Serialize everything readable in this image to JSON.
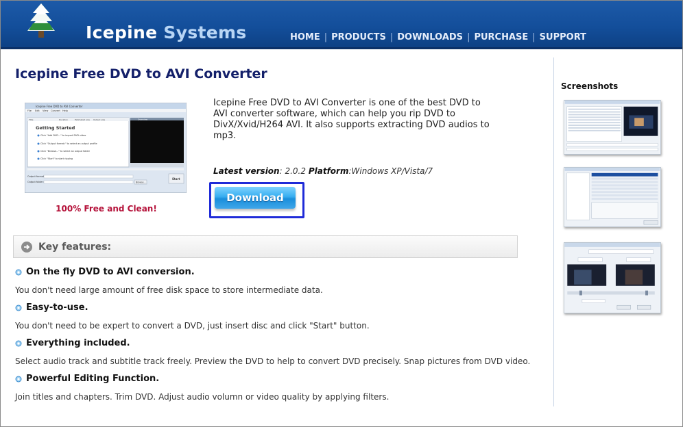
{
  "brand": {
    "name_part1": "Icepine",
    "name_part2": "Systems"
  },
  "nav": {
    "items": [
      "HOME",
      "PRODUCTS",
      "DOWNLOADS",
      "PURCHASE",
      "SUPPORT"
    ],
    "separator": "|"
  },
  "product": {
    "title": "Icepine Free DVD to AVI Converter",
    "tagline": "100% Free and Clean!",
    "description": "Icepine Free DVD to AVI Converter is one of the best DVD to AVI converter software, which can help you rip DVD to DivX/Xvid/H264 AVI. It also supports extracting DVD audios to mp3.",
    "version_label": "Latest version",
    "version_value": ": 2.0.2",
    "platform_label": "Platform",
    "platform_value": ":Windows XP/Vista/7",
    "download_label": "Download"
  },
  "screenshot_mini": {
    "window_title": "Icepine Free DVD to AVI Converter",
    "menu": [
      "File",
      "Edit",
      "View",
      "Convert",
      "Help"
    ],
    "columns": [
      "Title",
      "Duration",
      "Estimated size",
      "Output size"
    ],
    "overview_label": "Overview",
    "getting_started": "Getting Started",
    "steps": [
      "Click \"Add DVD...\" to import DVD video",
      "Click \"Output format:\" to select an output profile",
      "Click \"Browse...\" to select an output folder",
      "Click \"Start\" to start ripping"
    ],
    "output_format_label": "Output format:",
    "output_folder_label": "Output folder:",
    "browse_label": "Browse...",
    "start_label": "Start"
  },
  "features": {
    "heading": "Key features:",
    "items": [
      {
        "title": "On the fly DVD to AVI conversion.",
        "desc": "You don't need large amount of free disk space to store intermediate data."
      },
      {
        "title": "Easy-to-use.",
        "desc": "You don't need to be expert to convert a DVD, just insert disc and click \"Start\" button."
      },
      {
        "title": "Everything included.",
        "desc": "Select audio track and subtitle track freely. Preview the DVD to help to convert DVD precisely. Snap pictures from DVD video."
      },
      {
        "title": "Powerful Editing Function.",
        "desc": "Join titles and chapters. Trim DVD. Adjust audio volumn or video quality by applying filters."
      }
    ]
  },
  "sidebar": {
    "title": "Screenshots",
    "thumbs": [
      "screenshot-main-window",
      "screenshot-output-settings",
      "screenshot-clip-trim"
    ]
  },
  "colors": {
    "header_blue": "#134e9a",
    "title_navy": "#14206a",
    "tagline_red": "#b5123a",
    "download_blue": "#38aef0",
    "highlight_frame": "#1f2bd8"
  }
}
